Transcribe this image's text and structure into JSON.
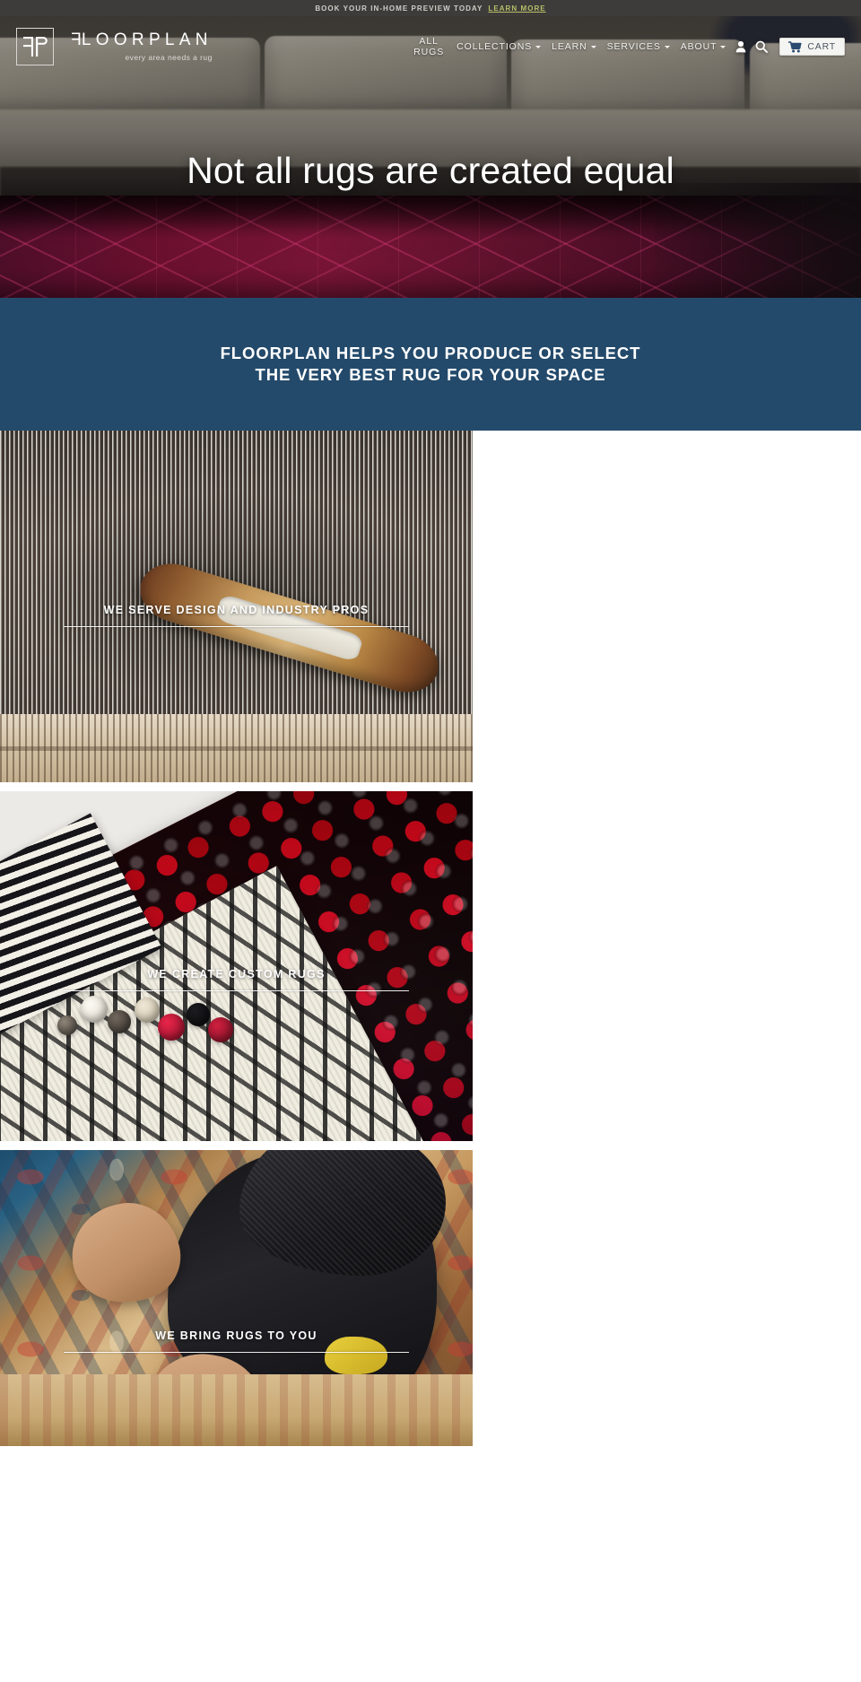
{
  "announcement": {
    "text": "BOOK YOUR IN-HOME PREVIEW TODAY",
    "link_label": "LEARN MORE"
  },
  "header": {
    "logo": {
      "monogram": "FP",
      "wordmark": "FLOORPLAN",
      "tagline": "every area needs a rug"
    },
    "nav": [
      {
        "label_line1": "ALL",
        "label_line2": "RUGS",
        "has_caret": false
      },
      {
        "label": "COLLECTIONS",
        "has_caret": true
      },
      {
        "label": "LEARN",
        "has_caret": true
      },
      {
        "label": "SERVICES",
        "has_caret": true
      },
      {
        "label": "ABOUT",
        "has_caret": true
      }
    ],
    "account_icon": "user-icon",
    "search_icon": "search-icon",
    "cart": {
      "label": "CART",
      "icon": "shopping-cart-icon"
    }
  },
  "hero": {
    "headline": "Not all rugs are created equal"
  },
  "promo": {
    "line1": "FLOORPLAN HELPS YOU PRODUCE OR SELECT",
    "line2": "THE VERY BEST RUG FOR YOUR SPACE",
    "background_color": "#234a6b"
  },
  "tiles": [
    {
      "caption": "WE SERVE DESIGN AND INDUSTRY PROS"
    },
    {
      "caption": "WE CREATE CUSTOM RUGS"
    },
    {
      "caption": "WE BRING RUGS TO YOU"
    }
  ],
  "colors": {
    "announce_bg": "#3d3c3a",
    "announce_link": "#b6bf6a",
    "promo_blue": "#234a6b",
    "cart_text": "#4b5563"
  }
}
